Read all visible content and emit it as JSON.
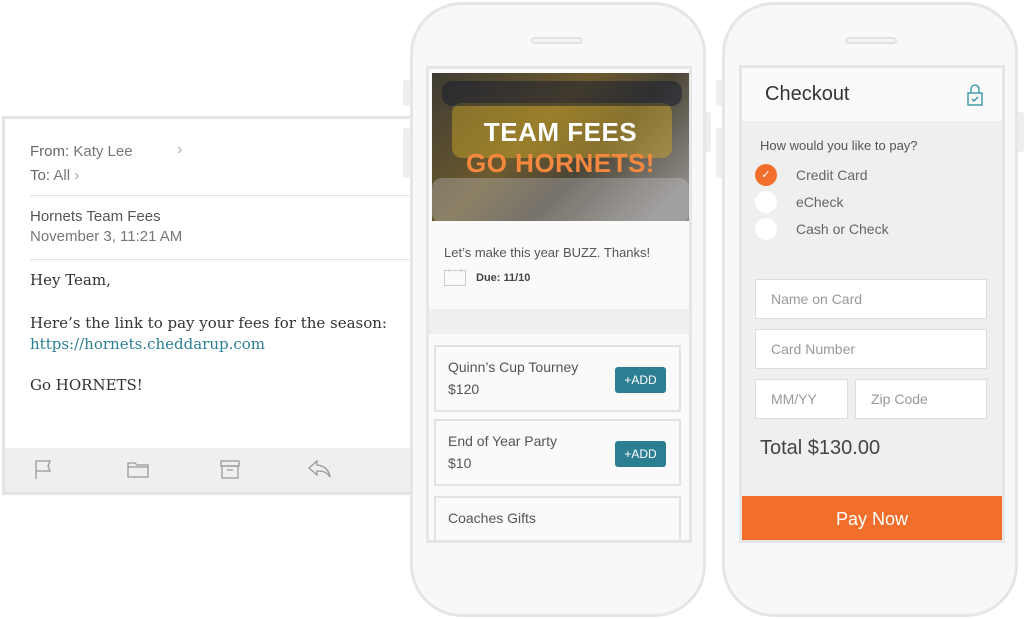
{
  "email": {
    "from_label": "From:",
    "from_value": "Katy Lee",
    "to_label": "To:",
    "to_value": "All",
    "subject": "Hornets Team Fees",
    "date": "November 3, 11:21 AM",
    "greeting": "Hey Team,",
    "body_line": "Here’s the link to pay your fees for the season:",
    "link": "https://hornets.cheddarup.com",
    "signoff": "Go HORNETS!",
    "toolbar_icons": [
      "flag-icon",
      "folder-icon",
      "archive-icon",
      "reply-icon"
    ]
  },
  "collection": {
    "hero_title": "TEAM FEES",
    "hero_subtitle": "GO HORNETS!",
    "description": "Let’s make this year BUZZ. Thanks!",
    "due": "Due: 11/10",
    "items": [
      {
        "name": "Quinn’s Cup Tourney",
        "price": "$120",
        "button": "+ADD"
      },
      {
        "name": "End of Year Party",
        "price": "$10",
        "button": "+ADD"
      },
      {
        "name": "Coaches Gifts"
      }
    ]
  },
  "checkout": {
    "title": "Checkout",
    "question": "How would you like to pay?",
    "options": [
      {
        "label": "Credit Card",
        "selected": true
      },
      {
        "label": "eCheck",
        "selected": false
      },
      {
        "label": "Cash or Check",
        "selected": false
      }
    ],
    "name_placeholder": "Name on Card",
    "card_placeholder": "Card Number",
    "exp_placeholder": "MM/YY",
    "zip_placeholder": "Zip Code",
    "total": "Total $130.00",
    "pay_button": "Pay Now"
  },
  "colors": {
    "accent": "#f26f2b",
    "teal": "#2c7f93"
  }
}
